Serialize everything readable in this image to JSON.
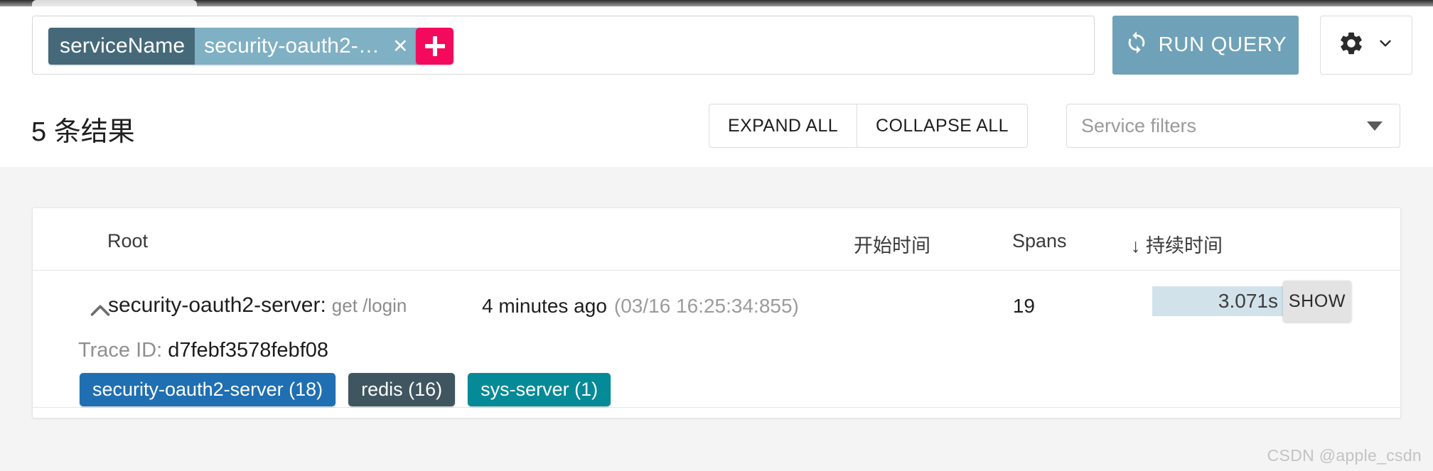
{
  "top_chrome": {
    "tab_stub": ""
  },
  "query_bar": {
    "filter_chip": {
      "key": "serviceName",
      "value": "security-oauth2-…",
      "remove_icon": "✕"
    },
    "add_filter_label": "+",
    "run_query_label": "RUN QUERY",
    "settings_icon": "gear-icon",
    "settings_caret": "chevron-down-icon"
  },
  "results_toolbar": {
    "result_count": "5 条结果",
    "expand_all_label": "EXPAND ALL",
    "collapse_all_label": "COLLAPSE ALL",
    "service_filters_placeholder": "Service filters"
  },
  "table": {
    "headers": {
      "root": "Root",
      "start_time": "开始时间",
      "spans": "Spans",
      "duration": "↓ 持续时间"
    },
    "rows": [
      {
        "expanded": true,
        "service": "security-oauth2-server:",
        "operation": "get /login",
        "relative_time": "4 minutes ago",
        "absolute_time": "(03/16 16:25:34:855)",
        "spans": "19",
        "duration": "3.071s",
        "show_label": "SHOW",
        "trace_id_label": "Trace ID:",
        "trace_id": "d7febf3578febf08",
        "service_badges": [
          {
            "label": "security-oauth2-server (18)",
            "color": "#1f6fb2"
          },
          {
            "label": "redis (16)",
            "color": "#3f5661"
          },
          {
            "label": "sys-server (1)",
            "color": "#058a97"
          }
        ]
      }
    ]
  },
  "watermark": "CSDN @apple_csdn",
  "colors": {
    "chip_key": "#46697a",
    "chip_value": "#7fb0c4",
    "add_button": "#f40a5c",
    "run_query": "#6fa2b8",
    "duration_bar": "#d2e2eb",
    "page_background": "#f4f4f4"
  }
}
